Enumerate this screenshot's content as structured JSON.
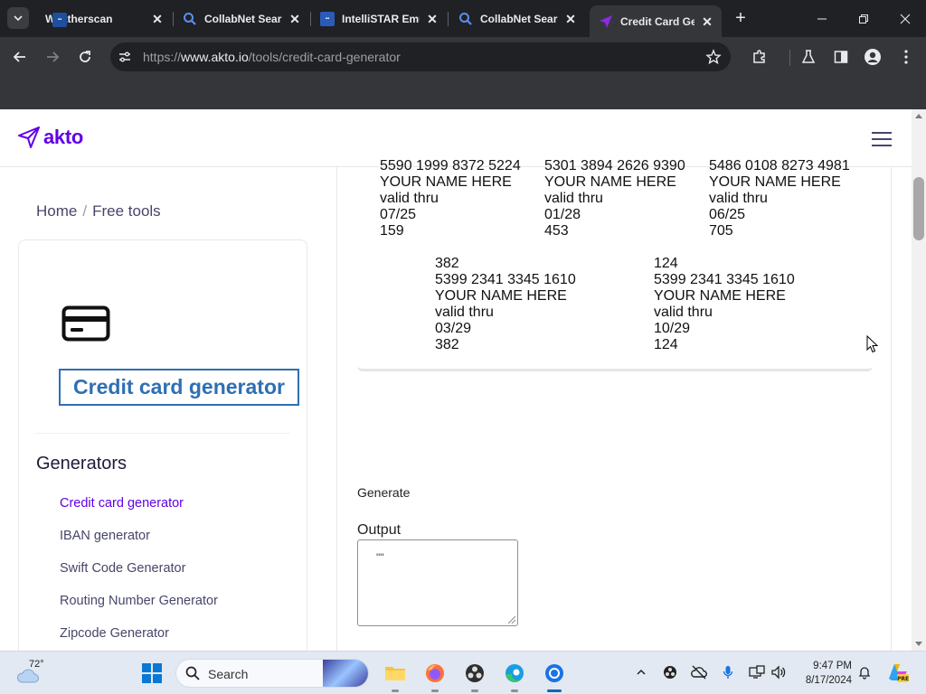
{
  "browser": {
    "tabs": [
      {
        "title": "Weatherscan",
        "favicon": "weatherscan-favicon"
      },
      {
        "title": "CollabNet Sear",
        "favicon": "search-favicon"
      },
      {
        "title": "IntelliSTAR Emu",
        "favicon": "intellistar-favicon"
      },
      {
        "title": "CollabNet Sear",
        "favicon": "search-favicon"
      },
      {
        "title": "Credit Card Ge",
        "favicon": "akto-favicon",
        "active": true
      }
    ],
    "address": {
      "scheme": "https://",
      "host": "www.akto.io",
      "path": "/tools/credit-card-generator"
    }
  },
  "site": {
    "logo_text": "akto",
    "brand_color": "#6200ea"
  },
  "breadcrumb": {
    "home": "Home",
    "separator": "/",
    "current": "Free tools"
  },
  "sidebar": {
    "tool_title": "Credit card generator",
    "section_heading": "Generators",
    "items": [
      {
        "label": "Credit card generator",
        "active": true
      },
      {
        "label": "IBAN generator"
      },
      {
        "label": "Swift Code Generator"
      },
      {
        "label": "Routing Number Generator"
      },
      {
        "label": "Zipcode Generator"
      }
    ]
  },
  "cards_row1": [
    {
      "number_partial": "5590 1999 8372 5224",
      "name": "YOUR NAME HERE",
      "valid": "valid thru",
      "expiry": "07/25",
      "cvv": "159"
    },
    {
      "number_partial": "5301 3894 2626 9390",
      "name": "YOUR NAME HERE",
      "valid": "valid thru",
      "expiry": "01/28",
      "cvv": "453"
    },
    {
      "number_partial": "5486 0108 8273 4981",
      "name": "YOUR NAME HERE",
      "valid": "valid thru",
      "expiry": "06/25",
      "cvv": "705"
    }
  ],
  "cards_row2": [
    {
      "cvv_top": "382",
      "number": "5399 2341 3345 1610",
      "name": "YOUR NAME HERE",
      "valid": "valid thru",
      "expiry": "03/29",
      "cvv": "382"
    },
    {
      "cvv_top": "124",
      "number": "5399 2341 3345 1610",
      "name": "YOUR NAME HERE",
      "valid": "valid thru",
      "expiry": "10/29",
      "cvv": "124"
    }
  ],
  "generate_label": "Generate",
  "output": {
    "label": "Output",
    "value": "\"\""
  },
  "taskbar": {
    "temperature": "72°",
    "search_placeholder": "Search",
    "time": "9:47 PM",
    "date": "8/17/2024"
  }
}
